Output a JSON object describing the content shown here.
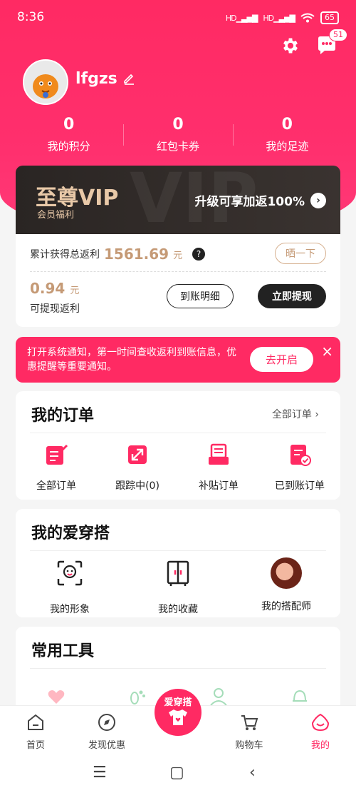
{
  "status": {
    "time": "8:36",
    "signal1": "HD",
    "signal2": "HD",
    "battery": "65"
  },
  "header": {
    "badge_count": "51"
  },
  "profile": {
    "username": "lfgzs"
  },
  "stats": [
    {
      "value": "0",
      "label": "我的积分"
    },
    {
      "value": "0",
      "label": "红包卡券"
    },
    {
      "value": "0",
      "label": "我的足迹"
    }
  ],
  "vip": {
    "title": "至尊VIP",
    "subtitle": "会员福利",
    "cta": "升级可享加返100%",
    "watermark": "VIP"
  },
  "rebate": {
    "total_label": "累计获得总返利",
    "total_value": "1561.69",
    "unit": "元",
    "share": "晒一下",
    "withdrawable_value": "0.94",
    "withdrawable_label": "可提现返利",
    "details_button": "到账明细",
    "withdraw_button": "立即提现"
  },
  "notify": {
    "text": "打开系统通知，第一时间查收返利到账信息，优惠提醒等重要通知。",
    "button": "去开启",
    "close": "×"
  },
  "orders": {
    "title": "我的订单",
    "more": "全部订单",
    "items": [
      {
        "label": "全部订单"
      },
      {
        "label": "跟踪中(0)"
      },
      {
        "label": "补贴订单"
      },
      {
        "label": "已到账订单"
      }
    ]
  },
  "outfit": {
    "title": "我的爱穿搭",
    "items": [
      {
        "label": "我的形象"
      },
      {
        "label": "我的收藏"
      },
      {
        "label": "我的搭配师"
      }
    ]
  },
  "tools": {
    "title": "常用工具"
  },
  "tabbar": {
    "home": "首页",
    "discover": "发现优惠",
    "center": "爱穿搭",
    "cart": "购物车",
    "mine": "我的"
  },
  "colors": {
    "accent": "#ff2a63",
    "gold": "#c59a76",
    "dark": "#222222"
  }
}
